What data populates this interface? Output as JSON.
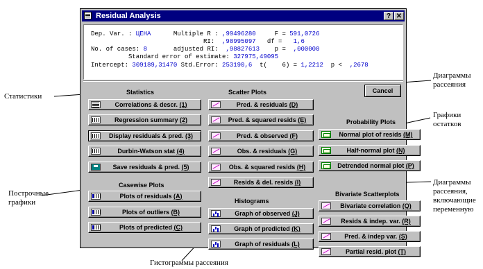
{
  "window": {
    "title": "Residual Analysis",
    "help_btn": "?",
    "close_btn": "✕"
  },
  "results": {
    "l1_a": "Dep. Var. : ",
    "l1_b": "ЦЕНА",
    "l1_c": "      Multiple R : ",
    "l1_d": ",99496280",
    "l1_e": "     F = ",
    "l1_f": "591,0726",
    "l2_a": "                              RI:  ",
    "l2_b": ",98995097",
    "l2_c": "   df =   ",
    "l2_d": "1,6",
    "l3_a": "No. of cases: ",
    "l3_b": "8",
    "l3_c": "       adjusted RI:  ",
    "l3_d": ",98827613",
    "l3_e": "    p =  ",
    "l3_f": ",000000",
    "l4_a": "          Standard error of estimate: ",
    "l4_b": "327975,49095",
    "l5_a": "Intercept: ",
    "l5_b": "309189,31470",
    "l5_c": " Std.Error: ",
    "l5_d": "253190,6",
    "l5_e": "  t(    6) = ",
    "l5_f": "1,2212",
    "l5_g": "  p <  ",
    "l5_h": ",2678"
  },
  "groups": {
    "statistics": "Statistics",
    "scatter": "Scatter Plots",
    "probability": "Probability Plots",
    "casewise": "Casewise Plots",
    "histograms": "Histograms",
    "bivariate": "Bivariate Scatterplots"
  },
  "buttons": {
    "cancel": "Cancel",
    "correlations": {
      "t": "Correlations & descr. ",
      "k": "(1)"
    },
    "regsummary": {
      "t": "Regression summary ",
      "k": "(2)"
    },
    "dispresid": {
      "t": "Display residuals & pred. ",
      "k": "(3)"
    },
    "durbin": {
      "t": "Durbin-Watson stat ",
      "k": "(4)"
    },
    "saveresid": {
      "t": "Save residuals & pred. ",
      "k": "(5)"
    },
    "predres": {
      "t": "Pred. & residuals ",
      "k": "(D)"
    },
    "predsq": {
      "t": "Pred. & squared resids ",
      "k": "(E)"
    },
    "predobs": {
      "t": "Pred. & observed ",
      "k": "(F)"
    },
    "obsres": {
      "t": "Obs. & residuals ",
      "k": "(G)"
    },
    "obssq": {
      "t": "Obs. & squared resids ",
      "k": "(H)"
    },
    "residdel": {
      "t": "Resids & del. resids ",
      "k": "(I)"
    },
    "normal": {
      "t": "Normal plot of resids ",
      "k": "(M)"
    },
    "halfnormal": {
      "t": "Half-normal plot ",
      "k": "(N)"
    },
    "detrended": {
      "t": "Detrended normal plot ",
      "k": "(P)"
    },
    "plotres": {
      "t": "Plots of residuals ",
      "k": "(A)"
    },
    "plotout": {
      "t": "Plots of outliers ",
      "k": "(B)"
    },
    "plotpred": {
      "t": "Plots of predicted ",
      "k": "(C)"
    },
    "graphobs": {
      "t": "Graph of observed ",
      "k": "(J)"
    },
    "graphpred": {
      "t": "Graph of predicted ",
      "k": "(K)"
    },
    "graphres": {
      "t": "Graph of residuals ",
      "k": "(L)"
    },
    "bivcorr": {
      "t": "Bivariate correlation ",
      "k": "(Q)"
    },
    "residindep": {
      "t": "Resids & indep. var. ",
      "k": "(R)"
    },
    "predindep": {
      "t": "Pred. & indep var. ",
      "k": "(S)"
    },
    "partial": {
      "t": "Partial resid. plot ",
      "k": "(T)"
    }
  },
  "annotations": {
    "statistiki": "Статистики",
    "diag_rass_1": "Диаграммы",
    "diag_rass_2": "рассеяния",
    "graf_ost_1": "Графики",
    "graf_ost_2": "остатков",
    "postr_1": "Построчные",
    "postr_2": "графики",
    "diag_bi_1": "Диаграммы",
    "diag_bi_2": "рассеяния,",
    "diag_bi_3": "включающие",
    "diag_bi_4": "переменную",
    "gist": "Гистограммы рассеяния"
  }
}
